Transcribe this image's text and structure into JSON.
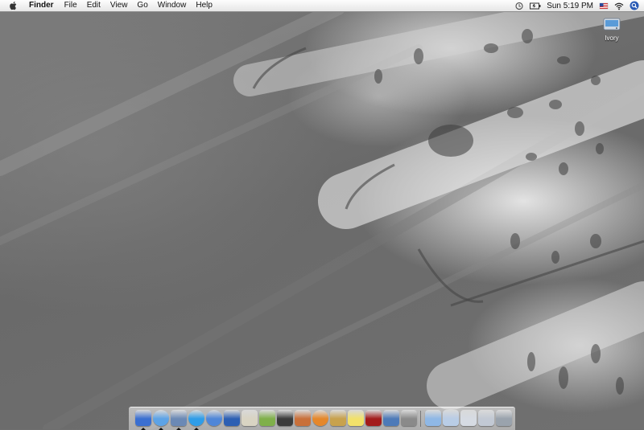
{
  "menubar": {
    "app_name": "Finder",
    "menus": [
      "File",
      "Edit",
      "View",
      "Go",
      "Window",
      "Help"
    ],
    "clock": "Sun 5:19 PM",
    "status_icons": [
      "spotlight-helper-icon",
      "battery-icon",
      "flag-icon",
      "wifi-icon",
      "spotlight-icon"
    ]
  },
  "desktop": {
    "icons": [
      {
        "label": "Ivory",
        "icon": "hard-drive-icon"
      }
    ]
  },
  "dock": {
    "items": [
      {
        "name": "finder",
        "color": "#3a6fd1"
      },
      {
        "name": "safari",
        "color": "#5da3e6"
      },
      {
        "name": "mail",
        "color": "#6b89b5"
      },
      {
        "name": "ichat",
        "color": "#2f9de8"
      },
      {
        "name": "itunes",
        "color": "#4f86d8"
      },
      {
        "name": "word",
        "color": "#2c5fb3"
      },
      {
        "name": "pen-app",
        "color": "#d9d4c3"
      },
      {
        "name": "clapper-app",
        "color": "#7fb04a"
      },
      {
        "name": "imovie",
        "color": "#3b3b3b"
      },
      {
        "name": "pen-tool-app",
        "color": "#c9703a"
      },
      {
        "name": "blender",
        "color": "#e5872a"
      },
      {
        "name": "brush-app",
        "color": "#c8a24d"
      },
      {
        "name": "stickies",
        "color": "#f2e16a"
      },
      {
        "name": "acrobat",
        "color": "#a31b1b"
      },
      {
        "name": "photo-app",
        "color": "#4d7ab8"
      },
      {
        "name": "system-preferences",
        "color": "#8a8a8a"
      },
      {
        "name": "applications-folder",
        "color": "#8fb8e6"
      },
      {
        "name": "documents-stack",
        "color": "#b9cde6"
      },
      {
        "name": "downloads-stack",
        "color": "#d6dbe3"
      },
      {
        "name": "pen-stack",
        "color": "#c2c9d4"
      },
      {
        "name": "trash",
        "color": "#9aa3ad"
      }
    ]
  }
}
